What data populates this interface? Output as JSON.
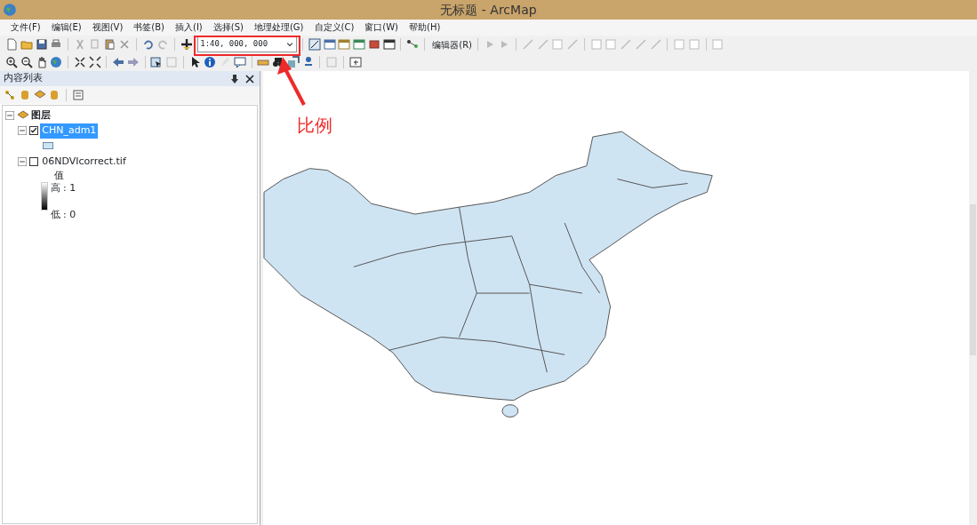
{
  "window": {
    "title": "无标题 - ArcMap"
  },
  "menu": [
    "文件(F)",
    "编辑(E)",
    "视图(V)",
    "书签(B)",
    "插入(I)",
    "选择(S)",
    "地理处理(G)",
    "自定义(C)",
    "窗口(W)",
    "帮助(H)"
  ],
  "toolbar": {
    "scale": "1:40, 000, 000",
    "editor_menu": "编辑器(R)"
  },
  "toc": {
    "title": "内容列表",
    "tree": {
      "label": "图层",
      "expanded": true,
      "children": [
        {
          "label": "CHN_adm1",
          "checked": true,
          "selected": true,
          "expanded": true,
          "legend": {
            "kind": "swatch"
          }
        },
        {
          "label": "06NDVIcorrect.tif",
          "checked": false,
          "selected": false,
          "expanded": true,
          "legend": {
            "kind": "ramp",
            "title": "值",
            "high": "高 : 1",
            "low": "低 : 0"
          }
        }
      ]
    }
  },
  "annotation": {
    "text": "比例"
  }
}
